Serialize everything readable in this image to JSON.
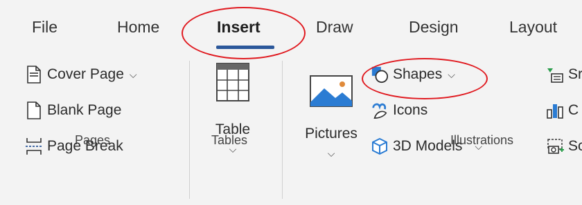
{
  "tabs": [
    {
      "label": "File"
    },
    {
      "label": "Home"
    },
    {
      "label": "Insert"
    },
    {
      "label": "Draw"
    },
    {
      "label": "Design"
    },
    {
      "label": "Layout"
    }
  ],
  "pages_group": {
    "label": "Pages",
    "items": [
      {
        "label": "Cover Page",
        "has_dropdown": true
      },
      {
        "label": "Blank Page"
      },
      {
        "label": "Page Break"
      }
    ]
  },
  "tables_group": {
    "label": "Tables",
    "table_label": "Table"
  },
  "illustrations_group": {
    "label": "Illustrations",
    "pictures_label": "Pictures",
    "items": [
      {
        "label": "Shapes",
        "has_dropdown": true
      },
      {
        "label": "Icons"
      },
      {
        "label": "3D Models",
        "has_dropdown": true
      }
    ],
    "cut_off_items": [
      {
        "label": "Sr"
      },
      {
        "label": "C"
      },
      {
        "label": "Sc"
      }
    ]
  },
  "colors": {
    "accent": "#2b579a",
    "highlight": "#e0191f",
    "background": "#f3f3f3"
  }
}
